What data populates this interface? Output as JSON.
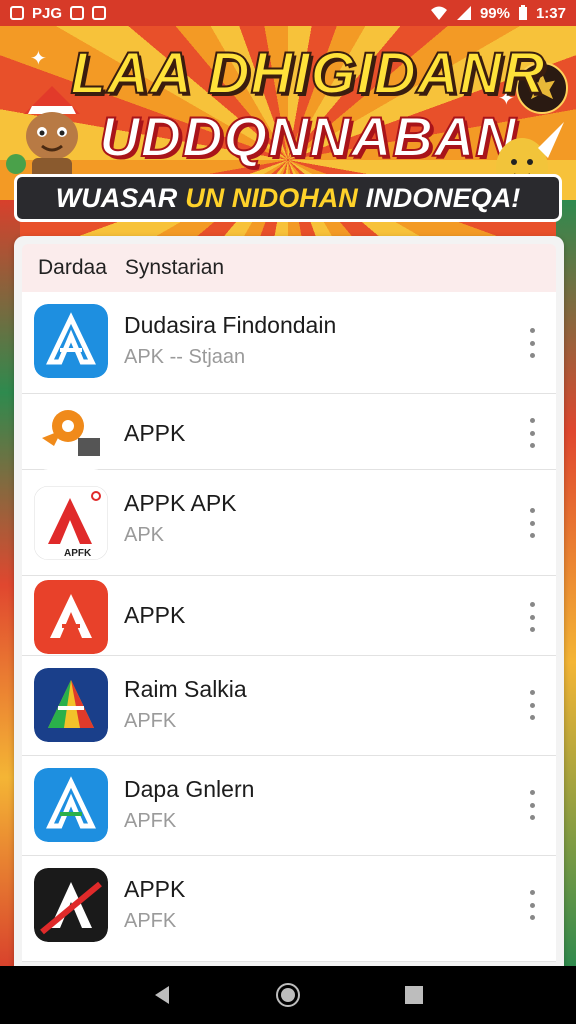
{
  "status_bar": {
    "left_text": "PJG",
    "battery": "99%",
    "time": "1:37"
  },
  "banner": {
    "title_line1": "LAA DHIGIDANR",
    "title_line2": "UDDQNNABAN",
    "subtitle_white": "WUASAR",
    "subtitle_yellow": "UN NIDOHAN",
    "subtitle_white2": "INDONEQA!"
  },
  "list": {
    "header_col1": "Dardaa",
    "header_col2": "Synstarian",
    "items": [
      {
        "name": "Dudasira Findondain",
        "sub": "APK -- Stjaan",
        "icon": "blue-a-icon"
      },
      {
        "name": "APPK",
        "sub": "",
        "icon": "orange-key-icon"
      },
      {
        "name": "APPK APK",
        "sub": "APK",
        "icon": "red-a-apk-icon"
      },
      {
        "name": "APPK",
        "sub": "",
        "icon": "red-a-icon"
      },
      {
        "name": "Raim Salkia",
        "sub": "APFK",
        "icon": "colorful-a-icon"
      },
      {
        "name": "Dapa Gnlern",
        "sub": "APFK",
        "icon": "blue-a-icon"
      },
      {
        "name": "APPK",
        "sub": "APFK",
        "icon": "black-a-icon"
      }
    ]
  },
  "colors": {
    "status_bar": "#d73a28",
    "title_yellow": "#ffe23a",
    "subtitle_bg": "#2a2a2e",
    "nav_bar": "#000000"
  }
}
